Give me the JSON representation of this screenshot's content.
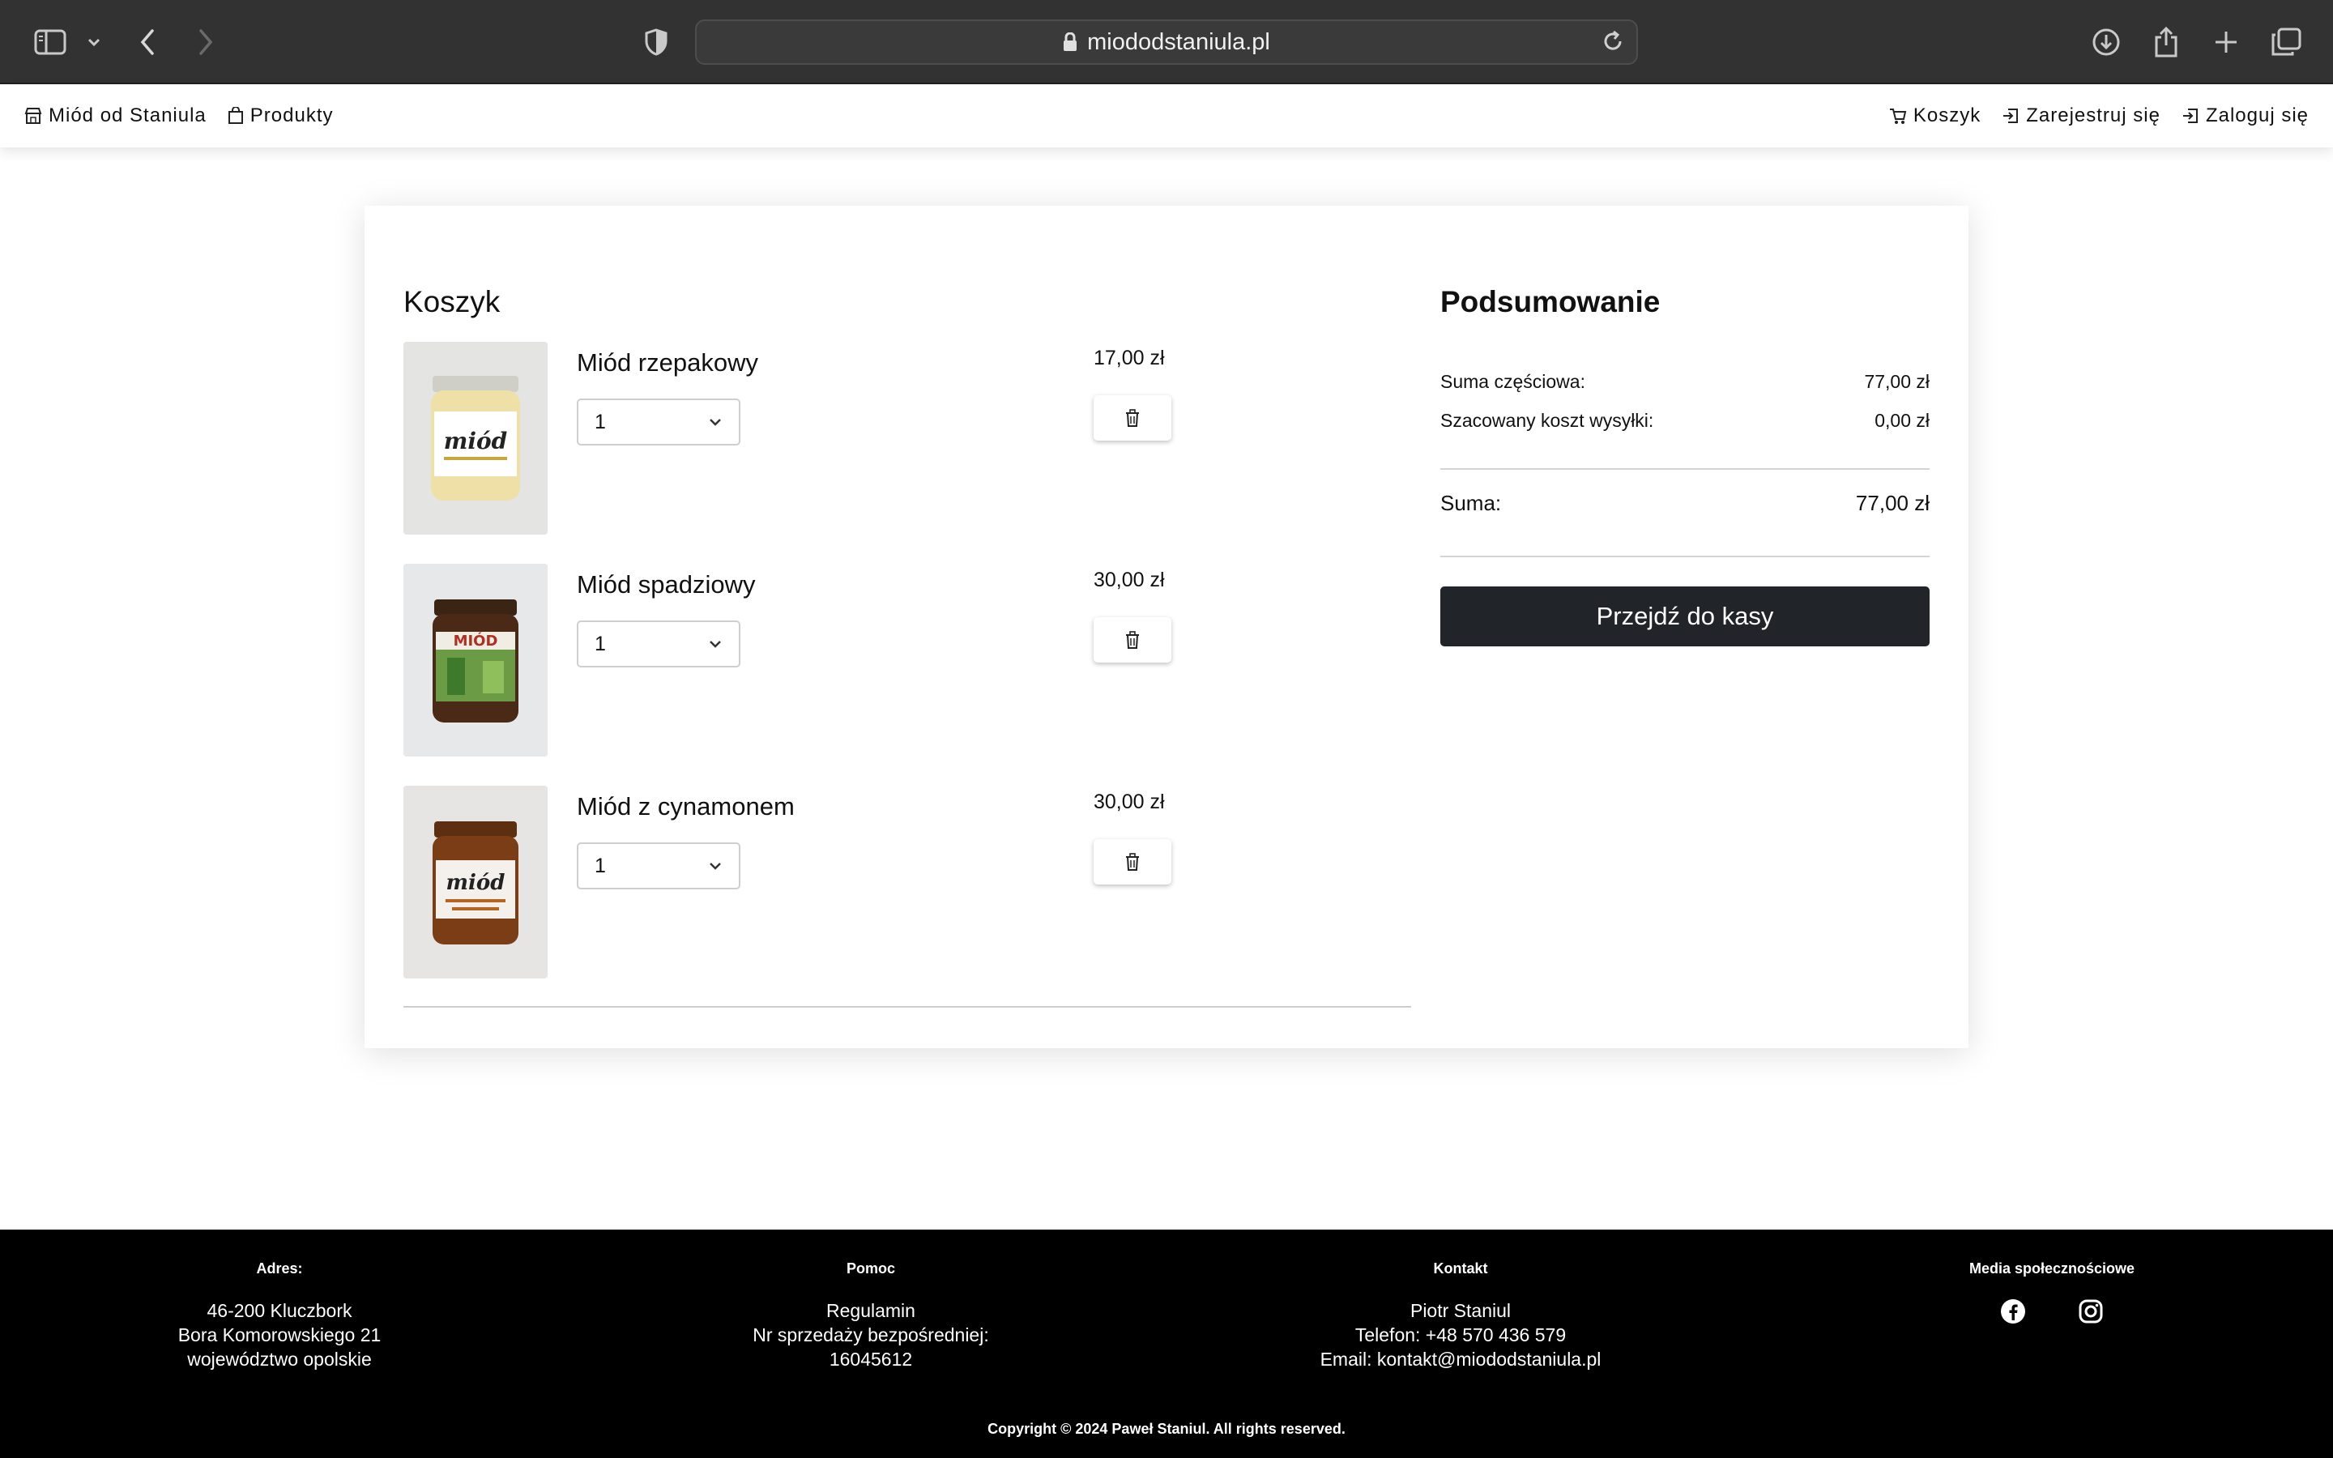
{
  "browser": {
    "url": "miododstaniula.pl"
  },
  "nav": {
    "brand": "Miód od Staniula",
    "products": "Produkty",
    "cart": "Koszyk",
    "register": "Zarejestruj się",
    "login": "Zaloguj się"
  },
  "cart": {
    "title": "Koszyk",
    "items": [
      {
        "name": "Miód rzepakowy",
        "quantity": "1",
        "price": "17,00 zł",
        "jar_color": "#efe0a8",
        "label_color": "#ffffff"
      },
      {
        "name": "Miód spadziowy",
        "quantity": "1",
        "price": "30,00 zł",
        "jar_color": "#4a2a16",
        "label_color": "#6b9c45"
      },
      {
        "name": "Miód z cynamonem",
        "quantity": "1",
        "price": "30,00 zł",
        "jar_color": "#7a3d16",
        "label_color": "#f4f1ec"
      }
    ]
  },
  "summary": {
    "title": "Podsumowanie",
    "subtotal_label": "Suma częściowa:",
    "subtotal_value": "77,00 zł",
    "shipping_label": "Szacowany koszt wysyłki:",
    "shipping_value": "0,00 zł",
    "total_label": "Suma:",
    "total_value": "77,00 zł",
    "checkout_label": "Przejdź do kasy"
  },
  "footer": {
    "address": {
      "heading": "Adres:",
      "line1": "46-200 Kluczbork",
      "line2": "Bora Komorowskiego 21",
      "line3": "województwo opolskie"
    },
    "help": {
      "heading": "Pomoc",
      "line1": "Regulamin",
      "line2": "Nr sprzedaży bezpośredniej:",
      "line3": "16045612"
    },
    "contact": {
      "heading": "Kontakt",
      "line1": "Piotr Staniul",
      "line2": "Telefon: +48 570 436 579",
      "line3": "Email: kontakt@miododstaniula.pl"
    },
    "social": {
      "heading": "Media społecznościowe"
    },
    "copyright": "Copyright © 2024 Paweł Staniul. All rights reserved."
  },
  "colors": {
    "chrome": "#323233",
    "button_dark": "#212529",
    "footer": "#000000"
  }
}
